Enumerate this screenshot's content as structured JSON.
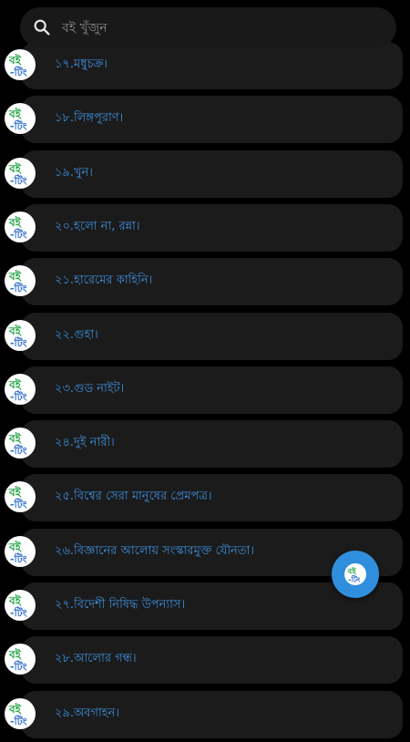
{
  "search": {
    "placeholder": "বই খুঁজুন"
  },
  "colors": {
    "background": "#000000",
    "card": "#1b1b1b",
    "label": "#3d8fdc",
    "fab": "#2f8fdd",
    "logo_green": "#2aa84a",
    "logo_blue": "#2f6fd0"
  },
  "icons": {
    "search": "search-icon",
    "item_logo": "boi-ting-logo-icon",
    "fab": "boi-ting-logo-icon"
  },
  "books": [
    {
      "label": "১৭.মধুচক্র।"
    },
    {
      "label": "১৮.লিঙ্গপুরাণ।"
    },
    {
      "label": "১৯.খুন।"
    },
    {
      "label": "২০.হলো না, রন্না।"
    },
    {
      "label": "২১.হারেমের কাহিনি।"
    },
    {
      "label": "২২.গুহা।"
    },
    {
      "label": "২৩.গুড নাইট।"
    },
    {
      "label": "২৪.দুই নারী।"
    },
    {
      "label": "২৫.বিশ্বের সেরা মানুষের প্রেমপত্র।"
    },
    {
      "label": "২৬.বিজ্ঞানের আলোয় সংস্কারমুক্ত যৌনতা।"
    },
    {
      "label": "২৭.বিদেশী নিষিদ্ধ উপন্যাস।"
    },
    {
      "label": "২৮.আলোর গন্ধ।"
    },
    {
      "label": "২৯.অবগাহন।"
    }
  ]
}
